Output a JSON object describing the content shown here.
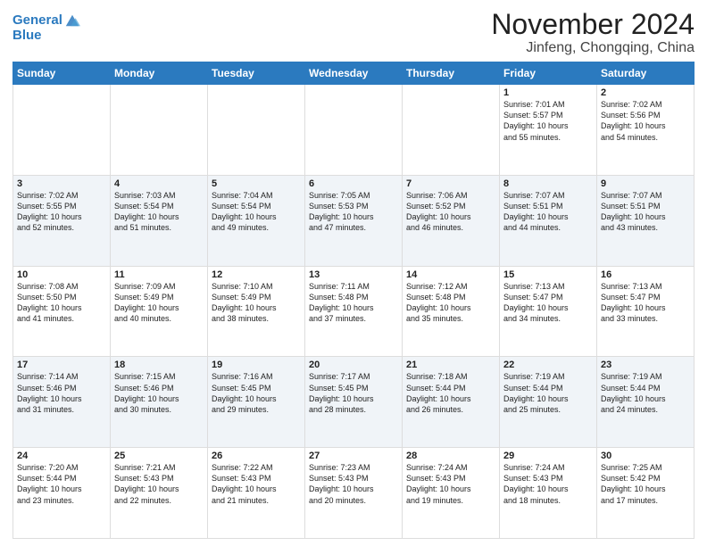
{
  "header": {
    "logo_line1": "General",
    "logo_line2": "Blue",
    "title": "November 2024",
    "subtitle": "Jinfeng, Chongqing, China"
  },
  "weekdays": [
    "Sunday",
    "Monday",
    "Tuesday",
    "Wednesday",
    "Thursday",
    "Friday",
    "Saturday"
  ],
  "weeks": [
    [
      {
        "day": "",
        "info": ""
      },
      {
        "day": "",
        "info": ""
      },
      {
        "day": "",
        "info": ""
      },
      {
        "day": "",
        "info": ""
      },
      {
        "day": "",
        "info": ""
      },
      {
        "day": "1",
        "info": "Sunrise: 7:01 AM\nSunset: 5:57 PM\nDaylight: 10 hours\nand 55 minutes."
      },
      {
        "day": "2",
        "info": "Sunrise: 7:02 AM\nSunset: 5:56 PM\nDaylight: 10 hours\nand 54 minutes."
      }
    ],
    [
      {
        "day": "3",
        "info": "Sunrise: 7:02 AM\nSunset: 5:55 PM\nDaylight: 10 hours\nand 52 minutes."
      },
      {
        "day": "4",
        "info": "Sunrise: 7:03 AM\nSunset: 5:54 PM\nDaylight: 10 hours\nand 51 minutes."
      },
      {
        "day": "5",
        "info": "Sunrise: 7:04 AM\nSunset: 5:54 PM\nDaylight: 10 hours\nand 49 minutes."
      },
      {
        "day": "6",
        "info": "Sunrise: 7:05 AM\nSunset: 5:53 PM\nDaylight: 10 hours\nand 47 minutes."
      },
      {
        "day": "7",
        "info": "Sunrise: 7:06 AM\nSunset: 5:52 PM\nDaylight: 10 hours\nand 46 minutes."
      },
      {
        "day": "8",
        "info": "Sunrise: 7:07 AM\nSunset: 5:51 PM\nDaylight: 10 hours\nand 44 minutes."
      },
      {
        "day": "9",
        "info": "Sunrise: 7:07 AM\nSunset: 5:51 PM\nDaylight: 10 hours\nand 43 minutes."
      }
    ],
    [
      {
        "day": "10",
        "info": "Sunrise: 7:08 AM\nSunset: 5:50 PM\nDaylight: 10 hours\nand 41 minutes."
      },
      {
        "day": "11",
        "info": "Sunrise: 7:09 AM\nSunset: 5:49 PM\nDaylight: 10 hours\nand 40 minutes."
      },
      {
        "day": "12",
        "info": "Sunrise: 7:10 AM\nSunset: 5:49 PM\nDaylight: 10 hours\nand 38 minutes."
      },
      {
        "day": "13",
        "info": "Sunrise: 7:11 AM\nSunset: 5:48 PM\nDaylight: 10 hours\nand 37 minutes."
      },
      {
        "day": "14",
        "info": "Sunrise: 7:12 AM\nSunset: 5:48 PM\nDaylight: 10 hours\nand 35 minutes."
      },
      {
        "day": "15",
        "info": "Sunrise: 7:13 AM\nSunset: 5:47 PM\nDaylight: 10 hours\nand 34 minutes."
      },
      {
        "day": "16",
        "info": "Sunrise: 7:13 AM\nSunset: 5:47 PM\nDaylight: 10 hours\nand 33 minutes."
      }
    ],
    [
      {
        "day": "17",
        "info": "Sunrise: 7:14 AM\nSunset: 5:46 PM\nDaylight: 10 hours\nand 31 minutes."
      },
      {
        "day": "18",
        "info": "Sunrise: 7:15 AM\nSunset: 5:46 PM\nDaylight: 10 hours\nand 30 minutes."
      },
      {
        "day": "19",
        "info": "Sunrise: 7:16 AM\nSunset: 5:45 PM\nDaylight: 10 hours\nand 29 minutes."
      },
      {
        "day": "20",
        "info": "Sunrise: 7:17 AM\nSunset: 5:45 PM\nDaylight: 10 hours\nand 28 minutes."
      },
      {
        "day": "21",
        "info": "Sunrise: 7:18 AM\nSunset: 5:44 PM\nDaylight: 10 hours\nand 26 minutes."
      },
      {
        "day": "22",
        "info": "Sunrise: 7:19 AM\nSunset: 5:44 PM\nDaylight: 10 hours\nand 25 minutes."
      },
      {
        "day": "23",
        "info": "Sunrise: 7:19 AM\nSunset: 5:44 PM\nDaylight: 10 hours\nand 24 minutes."
      }
    ],
    [
      {
        "day": "24",
        "info": "Sunrise: 7:20 AM\nSunset: 5:44 PM\nDaylight: 10 hours\nand 23 minutes."
      },
      {
        "day": "25",
        "info": "Sunrise: 7:21 AM\nSunset: 5:43 PM\nDaylight: 10 hours\nand 22 minutes."
      },
      {
        "day": "26",
        "info": "Sunrise: 7:22 AM\nSunset: 5:43 PM\nDaylight: 10 hours\nand 21 minutes."
      },
      {
        "day": "27",
        "info": "Sunrise: 7:23 AM\nSunset: 5:43 PM\nDaylight: 10 hours\nand 20 minutes."
      },
      {
        "day": "28",
        "info": "Sunrise: 7:24 AM\nSunset: 5:43 PM\nDaylight: 10 hours\nand 19 minutes."
      },
      {
        "day": "29",
        "info": "Sunrise: 7:24 AM\nSunset: 5:43 PM\nDaylight: 10 hours\nand 18 minutes."
      },
      {
        "day": "30",
        "info": "Sunrise: 7:25 AM\nSunset: 5:42 PM\nDaylight: 10 hours\nand 17 minutes."
      }
    ]
  ]
}
